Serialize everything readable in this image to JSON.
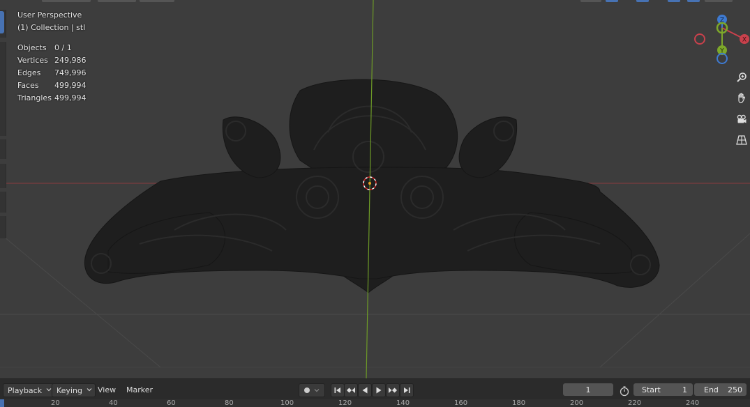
{
  "viewport": {
    "perspective_label": "User Perspective",
    "collection_label": "(1) Collection | stl",
    "stats": [
      {
        "key": "Objects",
        "value": "0 / 1"
      },
      {
        "key": "Vertices",
        "value": "249,986"
      },
      {
        "key": "Edges",
        "value": "749,996"
      },
      {
        "key": "Faces",
        "value": "499,994"
      },
      {
        "key": "Triangles",
        "value": "499,994"
      }
    ],
    "gizmo": {
      "z": "Z",
      "x": "X",
      "y": "Y"
    },
    "colors": {
      "x_axis": "#c9414c",
      "y_axis": "#7da82a",
      "z_axis": "#3e7ad1",
      "background": "#3d3d3d"
    },
    "nav_icons": [
      "zoom-icon",
      "hand-pan-icon",
      "camera-icon",
      "grid-perspective-icon"
    ]
  },
  "timeline": {
    "playback_label": "Playback",
    "keying_label": "Keying",
    "view_label": "View",
    "marker_label": "Marker",
    "current_frame": "1",
    "start_label": "Start",
    "start_value": "1",
    "end_label": "End",
    "end_value": "250",
    "ruler_ticks": [
      "20",
      "40",
      "60",
      "80",
      "100",
      "120",
      "140",
      "160",
      "180",
      "200",
      "220",
      "240"
    ]
  }
}
